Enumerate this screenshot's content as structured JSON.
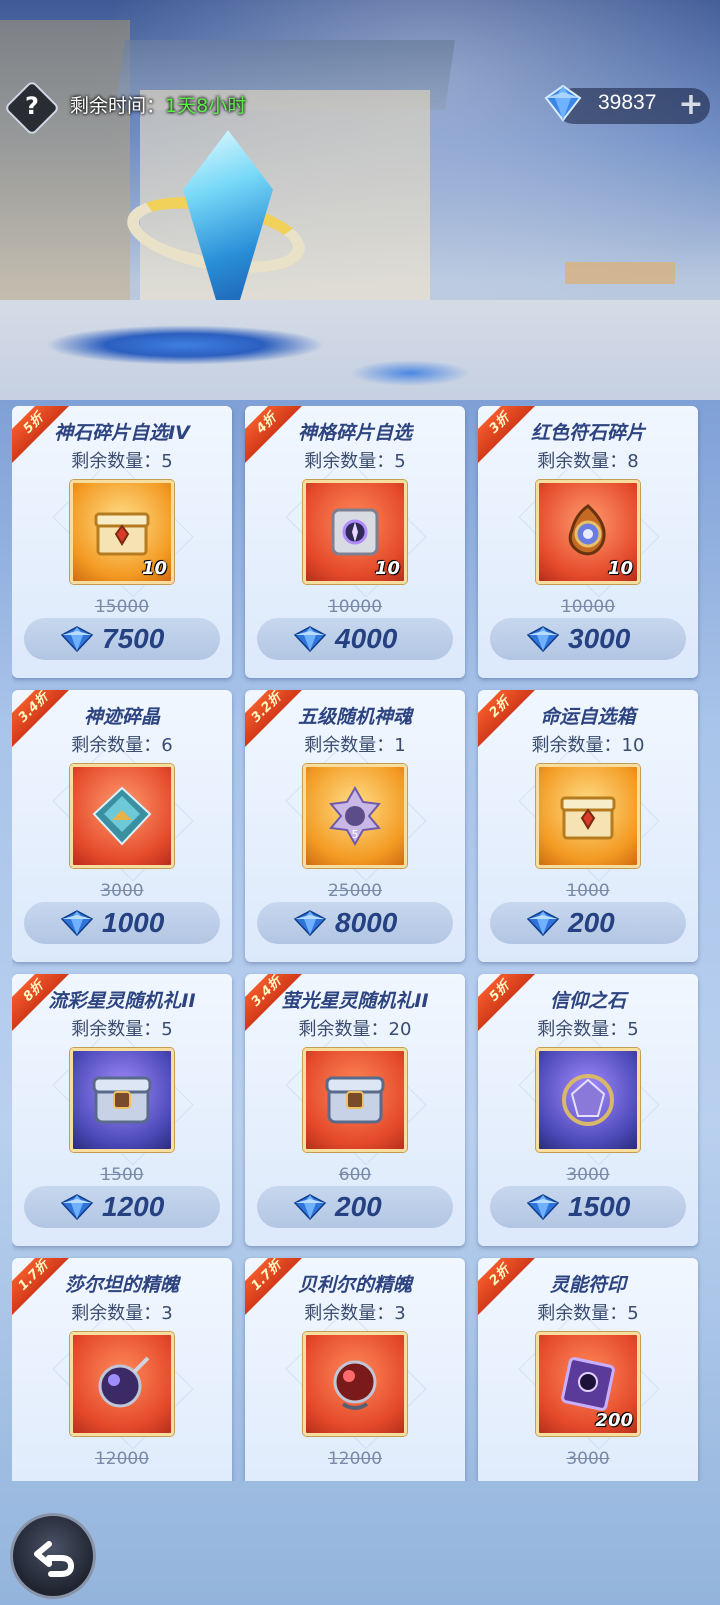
{
  "header": {
    "timer_label": "剩余时间：",
    "timer_value": "1天8小时",
    "currency_amount": "39837",
    "help_icon": "question-icon",
    "plus_icon": "plus-icon",
    "currency_icon": "diamond-icon"
  },
  "items": [
    {
      "discount": "5折",
      "name": "神石碎片自选IV",
      "stock_label": "剩余数量：",
      "stock": "5",
      "qty": "10",
      "old_price": "15000",
      "price": "7500",
      "icon": "golden-chest-icon",
      "bg": "gold"
    },
    {
      "discount": "4折",
      "name": "神格碎片自选",
      "stock_label": "剩余数量：",
      "stock": "5",
      "qty": "10",
      "old_price": "10000",
      "price": "4000",
      "icon": "cube-icon",
      "bg": "orange"
    },
    {
      "discount": "3折",
      "name": "红色符石碎片",
      "stock_label": "剩余数量：",
      "stock": "8",
      "qty": "10",
      "old_price": "10000",
      "price": "3000",
      "icon": "swirl-stone-icon",
      "bg": "red"
    },
    {
      "discount": "3.4折",
      "name": "神迹碎晶",
      "stock_label": "剩余数量：",
      "stock": "6",
      "qty": "",
      "old_price": "3000",
      "price": "1000",
      "icon": "crystal-shard-icon",
      "bg": "red"
    },
    {
      "discount": "3.2折",
      "name": "五级随机神魂",
      "stock_label": "剩余数量：",
      "stock": "1",
      "qty": "",
      "old_price": "25000",
      "price": "8000",
      "icon": "star-emblem-icon",
      "bg": "gold"
    },
    {
      "discount": "2折",
      "name": "命运自选箱",
      "stock_label": "剩余数量：",
      "stock": "10",
      "qty": "",
      "old_price": "1000",
      "price": "200",
      "icon": "golden-chest-icon",
      "bg": "gold"
    },
    {
      "discount": "8折",
      "name": "流彩星灵随机礼II",
      "stock_label": "剩余数量：",
      "stock": "5",
      "qty": "",
      "old_price": "1500",
      "price": "1200",
      "icon": "silver-chest-icon",
      "bg": "purple"
    },
    {
      "discount": "3.4折",
      "name": "萤光星灵随机礼II",
      "stock_label": "剩余数量：",
      "stock": "20",
      "qty": "",
      "old_price": "600",
      "price": "200",
      "icon": "silver-chest-icon",
      "bg": "orange"
    },
    {
      "discount": "5折",
      "name": "信仰之石",
      "stock_label": "剩余数量：",
      "stock": "5",
      "qty": "",
      "old_price": "3000",
      "price": "1500",
      "icon": "faith-stone-icon",
      "bg": "purple"
    },
    {
      "discount": "1.7折",
      "name": "莎尔坦的精魄",
      "stock_label": "剩余数量：",
      "stock": "3",
      "qty": "",
      "old_price": "12000",
      "price": "",
      "icon": "dark-orb-icon",
      "bg": "orange"
    },
    {
      "discount": "1.7折",
      "name": "贝利尔的精魄",
      "stock_label": "剩余数量：",
      "stock": "3",
      "qty": "",
      "old_price": "12000",
      "price": "",
      "icon": "red-orb-icon",
      "bg": "orange"
    },
    {
      "discount": "2折",
      "name": "灵能符印",
      "stock_label": "剩余数量：",
      "stock": "5",
      "qty": "200",
      "old_price": "3000",
      "price": "",
      "icon": "purple-seal-icon",
      "bg": "orange"
    }
  ],
  "footer": {
    "back_icon": "back-arrow-icon"
  },
  "colors": {
    "price_text": "#254181",
    "discount_ribbon": "#e04a22",
    "timer_value": "#5cf04a"
  }
}
